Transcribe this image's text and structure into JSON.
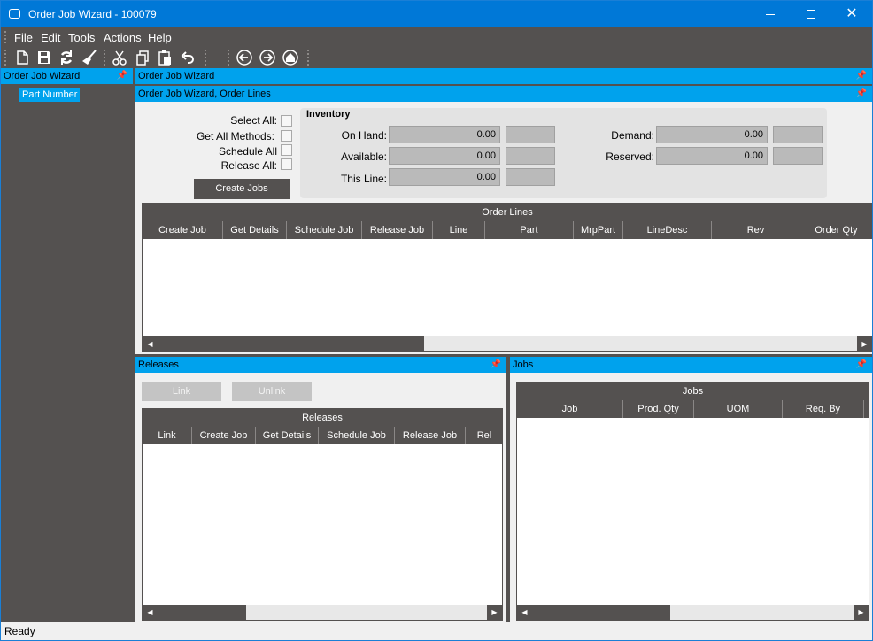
{
  "window": {
    "title": "Order Job Wizard - 100079"
  },
  "menu": [
    "File",
    "Edit",
    "Tools",
    "Actions",
    "Help"
  ],
  "toolbar": {
    "icons": [
      "new-icon",
      "save-icon",
      "refresh-icon",
      "clear-icon",
      "cut-icon",
      "copy-icon",
      "paste-icon",
      "undo-icon",
      "back-icon",
      "forward-icon",
      "home-icon"
    ]
  },
  "left_panel": {
    "header": "Order Job Wizard",
    "tree_item": "Part Number"
  },
  "main_panel": {
    "header": "Order Job Wizard",
    "subheader": "Order Job Wizard, Order Lines"
  },
  "options": {
    "select_all": "Select All:",
    "get_all_methods": "Get All Methods:",
    "schedule_all": "Schedule All",
    "release_all": "Release All:",
    "create_jobs": "Create Jobs"
  },
  "inventory": {
    "title": "Inventory",
    "on_hand_label": "On Hand:",
    "on_hand": "0.00",
    "available_label": "Available:",
    "available": "0.00",
    "this_line_label": "This Line:",
    "this_line": "0.00",
    "demand_label": "Demand:",
    "demand": "0.00",
    "reserved_label": "Reserved:",
    "reserved": "0.00"
  },
  "order_lines": {
    "caption": "Order Lines",
    "columns": [
      "Create Job",
      "Get Details",
      "Schedule Job",
      "Release Job",
      "Line",
      "Part",
      "MrpPart",
      "LineDesc",
      "Rev",
      "Order Qty"
    ]
  },
  "releases": {
    "header": "Releases",
    "link": "Link",
    "unlink": "Unlink",
    "caption": "Releases",
    "columns": [
      "Link",
      "Create Job",
      "Get Details",
      "Schedule Job",
      "Release Job",
      "Rel"
    ]
  },
  "jobs": {
    "header": "Jobs",
    "caption": "Jobs",
    "columns": [
      "Job",
      "Prod. Qty",
      "UOM",
      "Req. By"
    ]
  },
  "status": {
    "text": "Ready"
  }
}
